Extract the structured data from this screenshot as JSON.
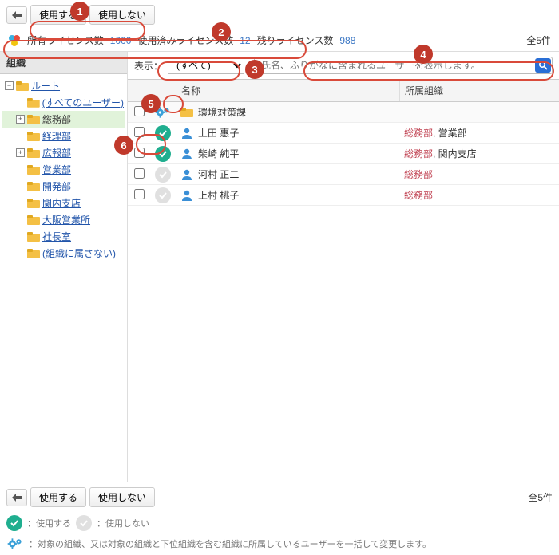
{
  "toolbar": {
    "use_label": "使用する",
    "not_use_label": "使用しない"
  },
  "license": {
    "total_label": "所有ライセンス数",
    "total_value": "1000",
    "used_label": "使用済みライセンス数",
    "used_value": "12",
    "remaining_label": "残りライセンス数",
    "remaining_value": "988",
    "count_label": "全5件"
  },
  "sidebar": {
    "header": "組織",
    "root": "ルート",
    "all_users": "(すべてのユーザー)",
    "items": {
      "soumu": "総務部",
      "keiri": "経理部",
      "kouhou": "広報部",
      "eigyou": "営業部",
      "kaihatsu": "開発部",
      "kannai": "関内支店",
      "osaka": "大阪営業所",
      "shachou": "社長室",
      "no_org": "(組織に属さない)"
    }
  },
  "filter": {
    "show_label": "表示：",
    "select_value": "(すべて)",
    "search_placeholder": "氏名、ふりがなに含まれるユーザーを表示します。"
  },
  "grid": {
    "headers": {
      "name": "名称",
      "org": "所属組織"
    },
    "group_label": "環境対策課",
    "rows": [
      {
        "name": "上田 惠子",
        "used": true,
        "org_primary": "総務部",
        "org_other": ", 営業部"
      },
      {
        "name": "柴崎 純平",
        "used": true,
        "org_primary": "総務部",
        "org_other": ", 関内支店"
      },
      {
        "name": "河村 正二",
        "used": false,
        "org_primary": "総務部",
        "org_other": ""
      },
      {
        "name": "上村 桃子",
        "used": false,
        "org_primary": "総務部",
        "org_other": ""
      }
    ]
  },
  "footer": {
    "use_label": "使用する",
    "not_use_label": "使用しない",
    "count_label": "全5件"
  },
  "legend": {
    "on": "：使用する",
    "off": "：使用しない",
    "gear": "：対象の組織、又は対象の組織と下位組織を含む組織に所属しているユーザーを一括して変更します。"
  },
  "callouts": {
    "c1": "1",
    "c2": "2",
    "c3": "3",
    "c4": "4",
    "c5": "5",
    "c6": "6"
  }
}
